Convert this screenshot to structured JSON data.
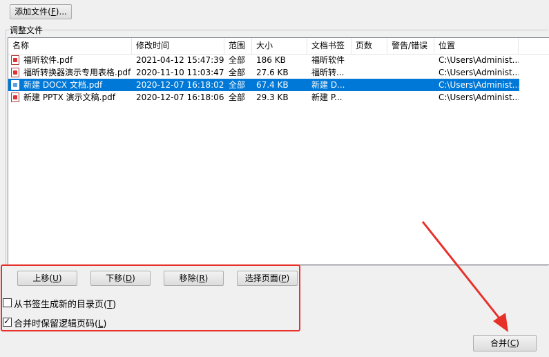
{
  "toolbar": {
    "add_file": "添加文件(",
    "add_file_key": "F",
    "add_file_tail": ")..."
  },
  "group": {
    "label": "调整文件"
  },
  "columns": [
    "名称",
    "修改时间",
    "范围",
    "大小",
    "文档书签",
    "页数",
    "警告/错误",
    "位置"
  ],
  "rows": [
    {
      "name": "福昕软件.pdf",
      "modified": "2021-04-12 15:47:39",
      "range": "全部",
      "size": "186 KB",
      "bookmark": "福昕软件",
      "pages": "",
      "warning": "",
      "location": "C:\\Users\\Administ...",
      "selected": false
    },
    {
      "name": "福昕转换器演示专用表格.pdf",
      "modified": "2020-11-10 11:03:47",
      "range": "全部",
      "size": "27.6 KB",
      "bookmark": "福昕转...",
      "pages": "",
      "warning": "",
      "location": "C:\\Users\\Administ...",
      "selected": false
    },
    {
      "name": "新建 DOCX 文档.pdf",
      "modified": "2020-12-07 16:18:02",
      "range": "全部",
      "size": "67.4 KB",
      "bookmark": "新建 D...",
      "pages": "",
      "warning": "",
      "location": "C:\\Users\\Administ...",
      "selected": true
    },
    {
      "name": "新建 PPTX 演示文稿.pdf",
      "modified": "2020-12-07 16:18:06",
      "range": "全部",
      "size": "29.3 KB",
      "bookmark": "新建 P...",
      "pages": "",
      "warning": "",
      "location": "C:\\Users\\Administ...",
      "selected": false
    }
  ],
  "actions": {
    "up": "上移(",
    "up_key": "U",
    "up_tail": ")",
    "down": "下移(",
    "down_key": "D",
    "down_tail": ")",
    "remove": "移除(",
    "remove_key": "R",
    "remove_tail": ")",
    "select_pages": "选择页面(",
    "select_pages_key": "P",
    "select_pages_tail": ")"
  },
  "options": {
    "toc_label": "从书签生成新的目录页(",
    "toc_key": "T",
    "toc_tail": ")",
    "toc_checked": false,
    "keep_label": "合并时保留逻辑页码(",
    "keep_key": "L",
    "keep_tail": ")",
    "keep_checked": true
  },
  "merge": {
    "label": "合并(",
    "key": "C",
    "tail": ")"
  },
  "colors": {
    "selection": "#0078d7",
    "annotation": "#e8302a"
  }
}
